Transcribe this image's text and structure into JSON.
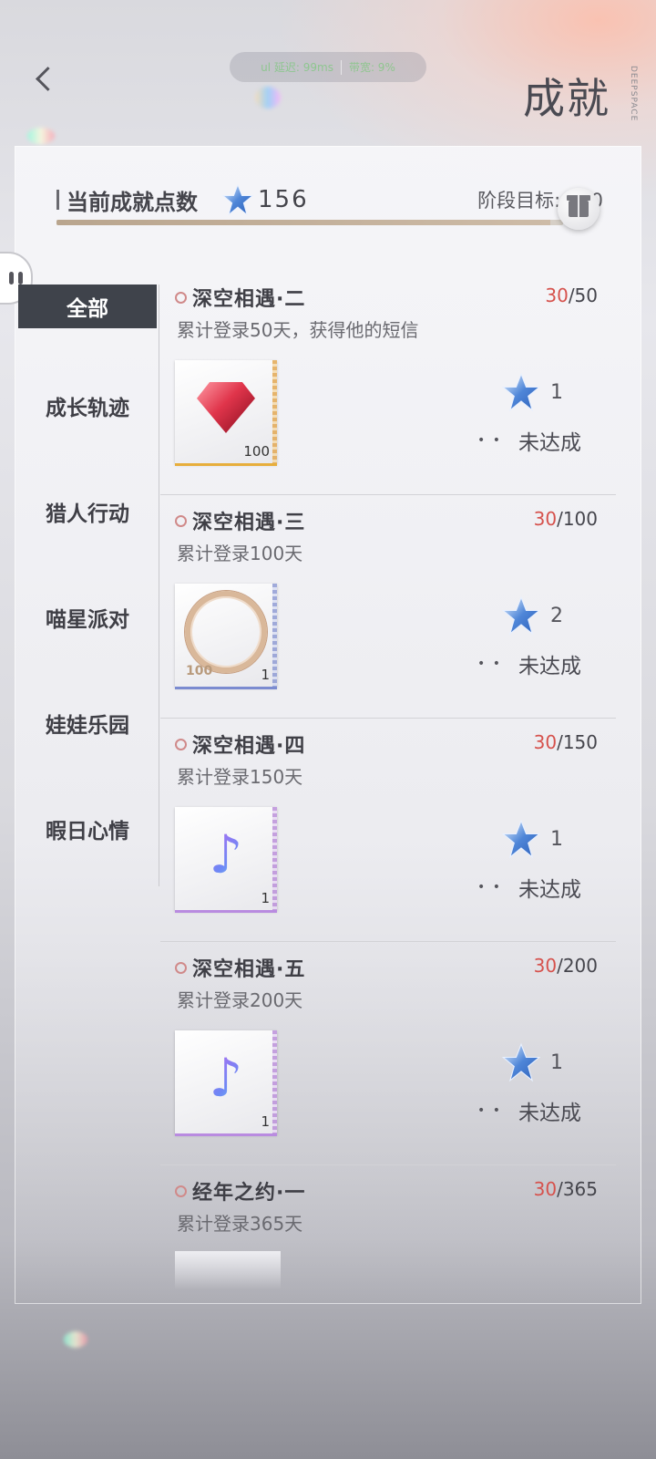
{
  "header": {
    "title": "成就",
    "brand": "DEEPSPACE",
    "net_left": "ul 延迟: 99ms",
    "net_right": "带宽: 9%"
  },
  "summary": {
    "points_label": "当前成就点数",
    "points_value": "156",
    "goal_label": "阶段目标: 160",
    "progress_ratio": 0.975
  },
  "sidebar": {
    "items": [
      {
        "label": "全部",
        "selected": true
      },
      {
        "label": "成长轨迹"
      },
      {
        "label": "猎人行动"
      },
      {
        "label": "喵星派对"
      },
      {
        "label": "娃娃乐园"
      },
      {
        "label": "暇日心情"
      }
    ]
  },
  "achievements": [
    {
      "title": "深空相遇·二",
      "current": "30",
      "total": "/50",
      "desc": "累计登录50天，获得他的短信",
      "reward": {
        "type": "gem",
        "qty": "100"
      },
      "points": "1",
      "status": "未达成"
    },
    {
      "title": "深空相遇·三",
      "current": "30",
      "total": "/100",
      "desc": "累计登录100天",
      "reward": {
        "type": "wreath",
        "qty": "1",
        "text": "100"
      },
      "points": "2",
      "status": "未达成"
    },
    {
      "title": "深空相遇·四",
      "current": "30",
      "total": "/150",
      "desc": "累计登录150天",
      "reward": {
        "type": "note",
        "qty": "1"
      },
      "points": "1",
      "status": "未达成"
    },
    {
      "title": "深空相遇·五",
      "current": "30",
      "total": "/200",
      "desc": "累计登录200天",
      "reward": {
        "type": "note",
        "qty": "1"
      },
      "points": "1",
      "status": "未达成"
    },
    {
      "title": "经年之约·一",
      "current": "30",
      "total": "/365",
      "desc": "累计登录365天"
    }
  ],
  "colors": {
    "progress_current": "#d6524d",
    "selected_tab_bg": "#3f434b",
    "star": "#4f86d8"
  },
  "icons": {
    "back": "chevron-left-icon",
    "gift": "gift-icon",
    "star": "star-icon",
    "menu": "pause-icon"
  }
}
